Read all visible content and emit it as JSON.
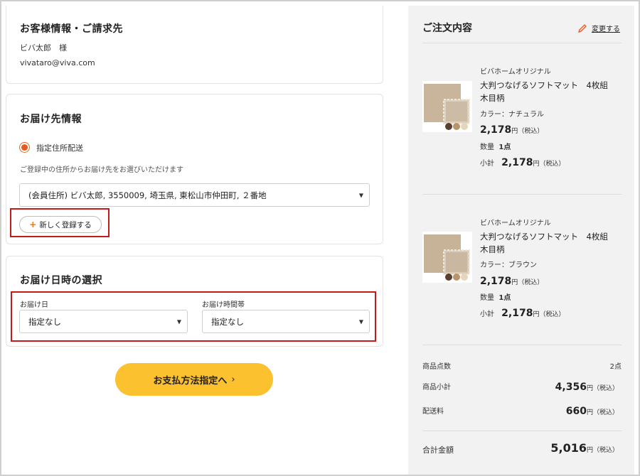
{
  "customer": {
    "title": "お客様情報・ご請求先",
    "name": "ビバ太郎　様",
    "email": "vivataro@viva.com"
  },
  "delivery": {
    "title": "お届け先情報",
    "radio_label": "指定住所配送",
    "hint": "ご登録中の住所からお届け先をお選びいただけます",
    "address_selected": "(会員住所) ビバ太郎, 3550009, 埼玉県, 東松山市仲田町, ２番地",
    "new_button": "新しく登録する",
    "new_button_plus": "+"
  },
  "datetime": {
    "title": "お届け日時の選択",
    "date_label": "お届け日",
    "date_value": "指定なし",
    "time_label": "お届け時間帯",
    "time_value": "指定なし"
  },
  "cta": {
    "label": "お支払方法指定へ",
    "chevron": "›"
  },
  "summary": {
    "title": "ご注文内容",
    "edit_label": "変更する",
    "items": [
      {
        "brand": "ビバホームオリジナル",
        "name_line1": "大判つなげるソフトマット　4枚組",
        "name_line2": "木目柄",
        "color": "カラー：ナチュラル",
        "price": "2,178",
        "yen": "円",
        "tax": "（税込）",
        "qty_label": "数量",
        "qty": "1点",
        "subtotal_label": "小計",
        "subtotal": "2,178",
        "subtotal_yen": "円",
        "subtotal_tax": "（税込）"
      },
      {
        "brand": "ビバホームオリジナル",
        "name_line1": "大判つなげるソフトマット　4枚組",
        "name_line2": "木目柄",
        "color": "カラー：ブラウン",
        "price": "2,178",
        "yen": "円",
        "tax": "（税込）",
        "qty_label": "数量",
        "qty": "1点",
        "subtotal_label": "小計",
        "subtotal": "2,178",
        "subtotal_yen": "円",
        "subtotal_tax": "（税込）"
      }
    ],
    "count_label": "商品点数",
    "count_value": "2点",
    "items_subtotal_label": "商品小計",
    "items_subtotal_value": "4,356",
    "shipping_label": "配送料",
    "shipping_value": "660",
    "total_label": "合計金額",
    "total_value": "5,016",
    "yen": "円",
    "tax": "（税込）"
  },
  "colors": {
    "accent_orange": "#e8591a",
    "cta_yellow": "#fbc12f",
    "highlight_red": "#c41a1a",
    "summary_bg": "#f2f2f2"
  }
}
